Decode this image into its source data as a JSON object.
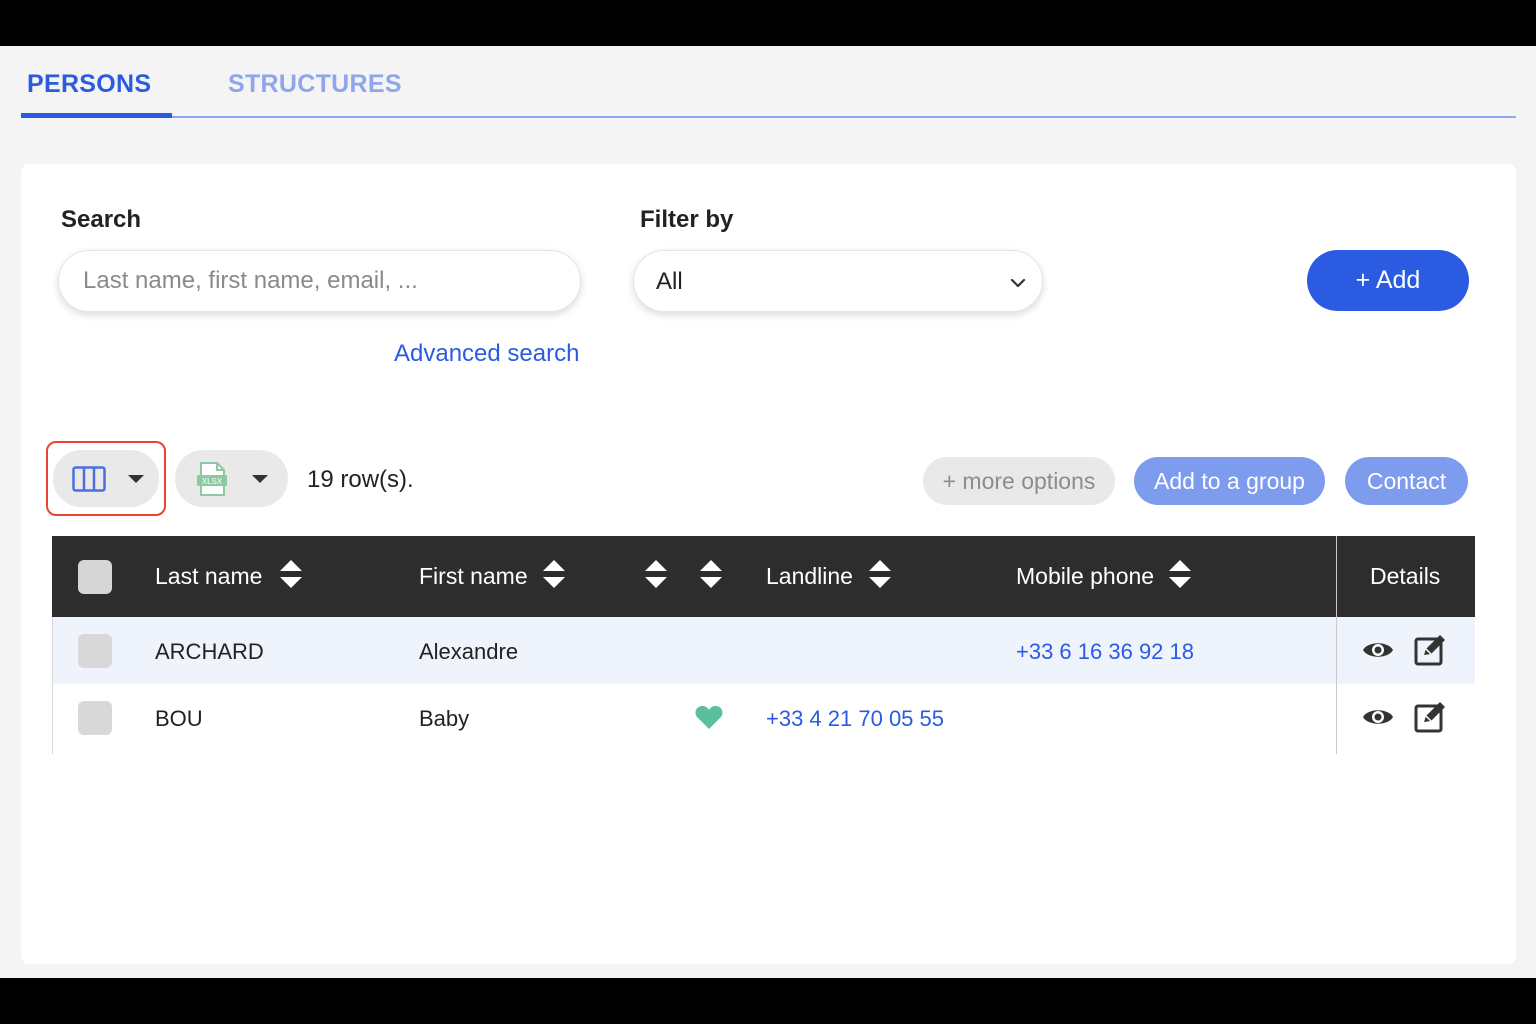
{
  "tabs": [
    {
      "label": "PERSONS",
      "active": true
    },
    {
      "label": "STRUCTURES",
      "active": false
    }
  ],
  "search": {
    "label": "Search",
    "placeholder": "Last name, first name, email, ...",
    "advanced_link": "Advanced search"
  },
  "filter": {
    "label": "Filter by",
    "value": "All"
  },
  "add_button": "+ Add",
  "toolbar": {
    "columns_icon": "columns-icon",
    "export_icon": "xlsx-file-icon",
    "row_count": "19 row(s).",
    "more_options": "+ more options",
    "add_to_group": "Add to a group",
    "contact": "Contact"
  },
  "table": {
    "headers": {
      "last_name": "Last name",
      "first_name": "First name",
      "landline": "Landline",
      "mobile_phone": "Mobile phone",
      "details": "Details"
    },
    "rows": [
      {
        "last_name": "ARCHARD",
        "first_name": "Alexandre",
        "favorite": false,
        "landline": "",
        "mobile_phone": "+33 6 16 36 92 18"
      },
      {
        "last_name": "BOU",
        "first_name": "Baby",
        "favorite": true,
        "landline": "+33 4 21 70 05 55",
        "mobile_phone": ""
      }
    ]
  },
  "colors": {
    "accent": "#2a5be0",
    "accent_light": "#7e9cee",
    "favorite": "#5bbf9d",
    "header_bg": "#2d2d2d"
  }
}
